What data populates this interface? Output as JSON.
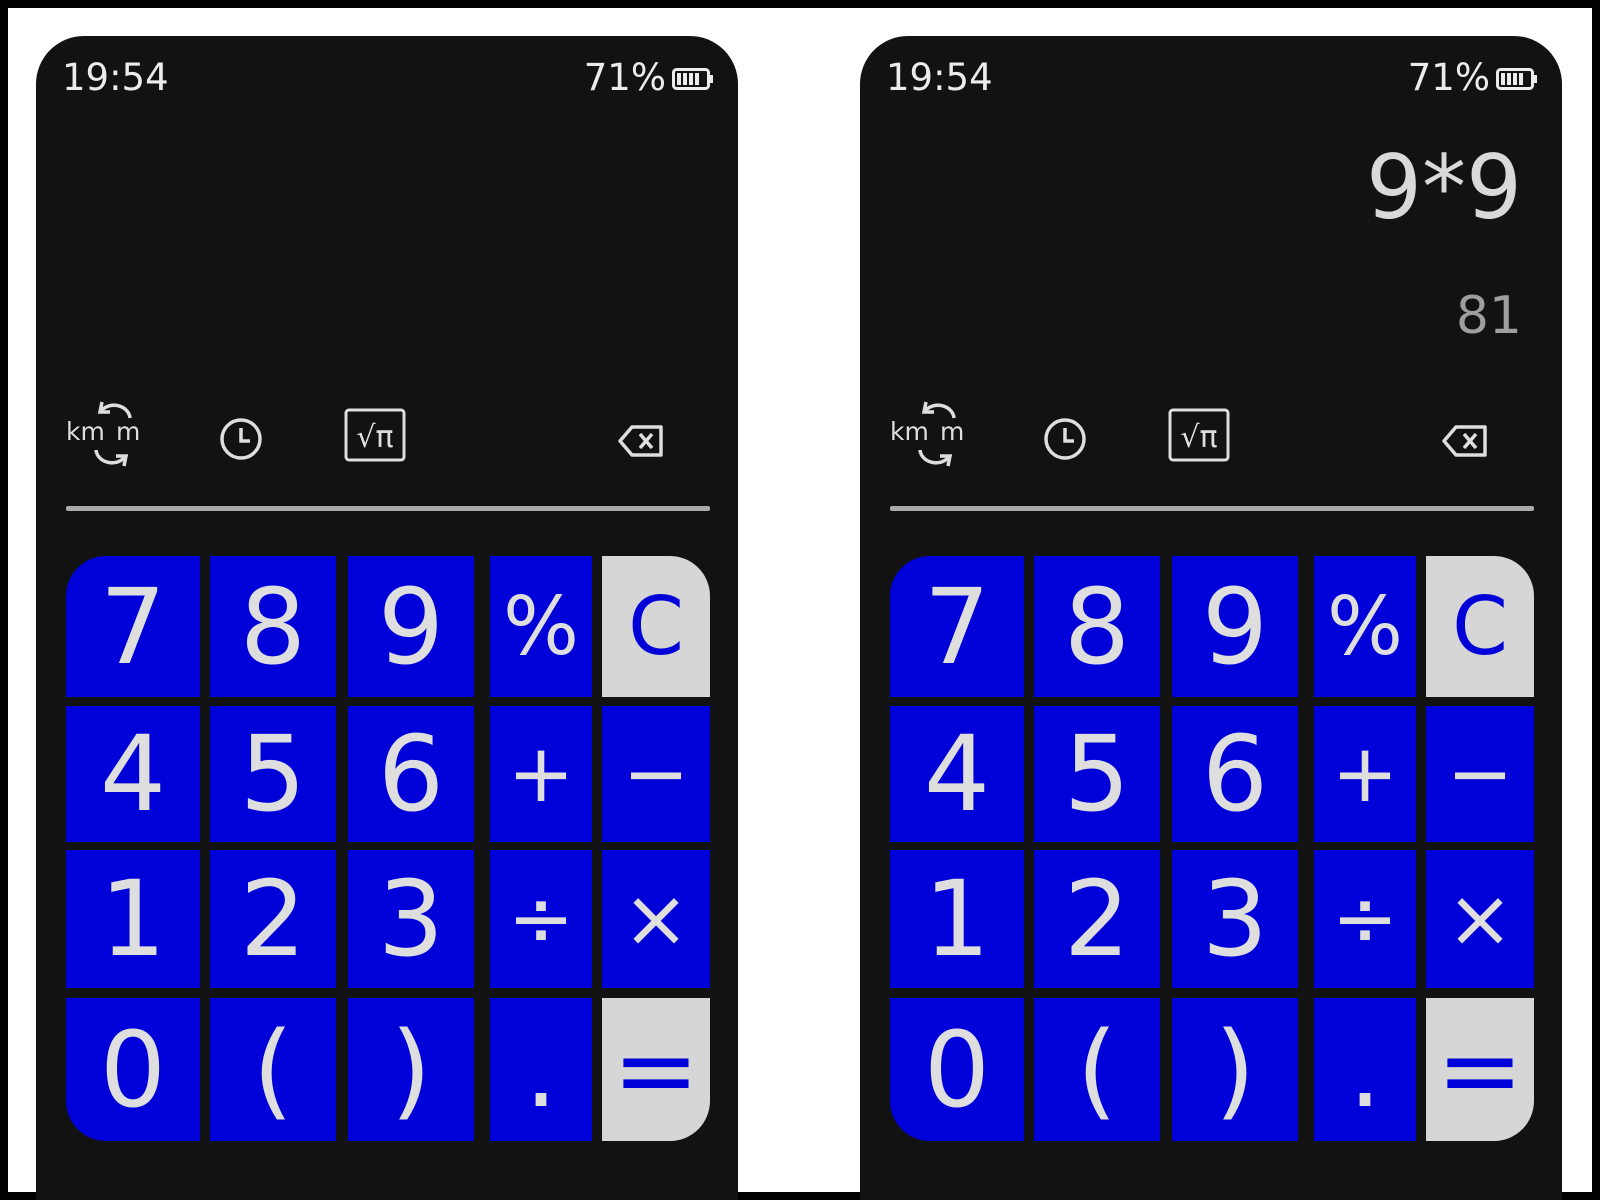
{
  "status_bar": {
    "time": "19:54",
    "battery": "71%"
  },
  "left_screen": {
    "expression": "",
    "result": ""
  },
  "right_screen": {
    "expression": "9*9",
    "result": "81"
  },
  "toolbar": {
    "converter_icon": "unit-converter-icon",
    "history_icon": "history-clock-icon",
    "scientific_icon": "scientific-sqrt-pi-icon",
    "backspace_icon": "backspace-icon",
    "scientific_label": "√π",
    "converter_from": "km",
    "converter_to": "m"
  },
  "keys": {
    "k7": "7",
    "k8": "8",
    "k9": "9",
    "percent": "%",
    "clear": "C",
    "k4": "4",
    "k5": "5",
    "k6": "6",
    "plus": "+",
    "minus": "−",
    "k1": "1",
    "k2": "2",
    "k3": "3",
    "divide": "÷",
    "multiply": "×",
    "k0": "0",
    "lparen": "(",
    "rparen": ")",
    "dot": ".",
    "equals": "="
  },
  "colors": {
    "key_blue": "#0000d8",
    "key_light": "#d6d6d6",
    "background": "#121212",
    "key_text": "#dedede"
  }
}
